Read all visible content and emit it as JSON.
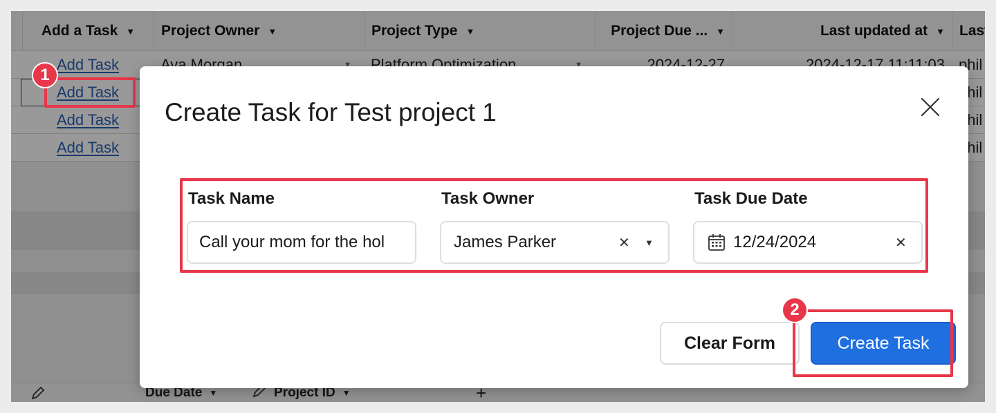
{
  "grid": {
    "headers": [
      "Add a Task",
      "Project Owner",
      "Project Type",
      "Project Due ...",
      "Last updated at",
      "Last"
    ],
    "rows": [
      {
        "link": "Add Task",
        "owner": "Ava Morgan",
        "type": "Platform Optimization",
        "due": "2024-12-27",
        "updated": "2024-12-17 11:11:03",
        "last": "phil"
      },
      {
        "link": "Add Task",
        "last": "phil"
      },
      {
        "link": "Add Task",
        "last": "phil"
      },
      {
        "link": "Add Task",
        "last": "phil"
      }
    ],
    "footer": {
      "due_date": "Due Date",
      "project_id": "Project ID",
      "add": "+"
    }
  },
  "annotations": {
    "badge1": "1",
    "badge2": "2",
    "color": "#e8374a"
  },
  "modal": {
    "title": "Create Task for Test project 1",
    "fields": {
      "task_name": {
        "label": "Task Name",
        "value": "Call your mom for the hol"
      },
      "task_owner": {
        "label": "Task Owner",
        "value": "James Parker"
      },
      "task_due_date": {
        "label": "Task Due Date",
        "value": "12/24/2024"
      }
    },
    "buttons": {
      "clear": "Clear Form",
      "create": "Create Task"
    },
    "accent": "#1f6fe0"
  }
}
